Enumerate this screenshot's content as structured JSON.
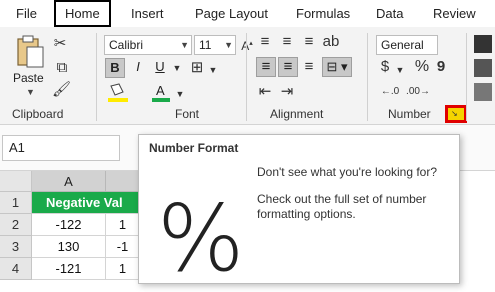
{
  "tabs": [
    "File",
    "Home",
    "Insert",
    "Page Layout",
    "Formulas",
    "Data",
    "Review"
  ],
  "clipboard": {
    "paste_label": "Paste",
    "group_label": "Clipboard"
  },
  "font": {
    "name": "Calibri",
    "size": "11",
    "group_label": "Font",
    "bold": "B",
    "italic": "I",
    "underline": "U"
  },
  "alignment": {
    "group_label": "Alignment"
  },
  "number": {
    "format": "General",
    "currency": "$",
    "percent": "%",
    "comma": "9",
    "group_label": "Number"
  },
  "name_box": "A1",
  "columns": [
    "A"
  ],
  "rows": [
    "1",
    "2",
    "3",
    "4"
  ],
  "cells": {
    "a1": "Negative Val",
    "b1": "",
    "a2": "-122",
    "b2": "1",
    "a3": "130",
    "b3": "-1",
    "a4": "-121",
    "b4": "1"
  },
  "tooltip": {
    "title": "Number Format",
    "line1": "Don't see what you're looking for?",
    "line2": "Check out the full set of number formatting options.",
    "symbol": "%"
  },
  "colors": {
    "accent_green": "#1aaa4a",
    "highlight_red": "#e00000",
    "launcher_yellow": "#f5d400"
  }
}
